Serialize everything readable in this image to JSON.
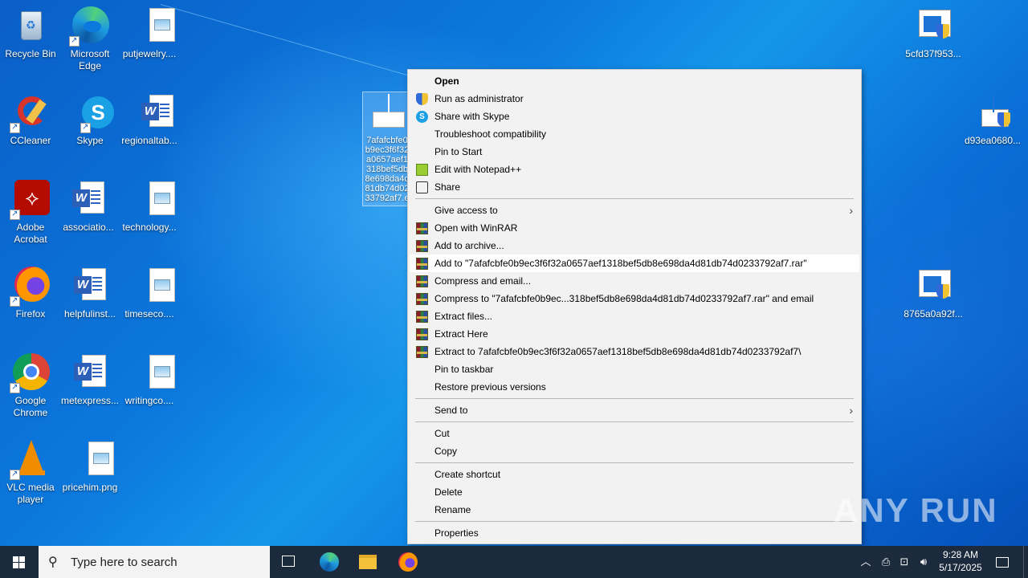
{
  "desktop": {
    "icons": [
      {
        "label": "Recycle Bin"
      },
      {
        "label": "Microsoft Edge"
      },
      {
        "label": "putjewelry...."
      },
      {
        "label": "CCleaner"
      },
      {
        "label": "Skype"
      },
      {
        "label": "regionaltab..."
      },
      {
        "label": "Adobe Acrobat"
      },
      {
        "label": "associatio..."
      },
      {
        "label": "technology..."
      },
      {
        "label": "Firefox"
      },
      {
        "label": "helpfulinst..."
      },
      {
        "label": "timeseco...."
      },
      {
        "label": "Google Chrome"
      },
      {
        "label": "metexpress..."
      },
      {
        "label": "writingco...."
      },
      {
        "label": "VLC media player"
      },
      {
        "label": "pricehim.png"
      },
      {
        "label": "5cfd37f953..."
      },
      {
        "label": "d93ea0680..."
      },
      {
        "label": "8765a0a92f..."
      }
    ],
    "selected_file_label": "7afafcbfe0b9ec3f6f32a0657aef1318bef5db8e698da4d81db74d0233792af7.exe"
  },
  "context_menu": {
    "items": [
      {
        "label": "Open"
      },
      {
        "label": "Run as administrator"
      },
      {
        "label": "Share with Skype"
      },
      {
        "label": "Troubleshoot compatibility"
      },
      {
        "label": "Pin to Start"
      },
      {
        "label": "Edit with Notepad++"
      },
      {
        "label": "Share"
      },
      {
        "label": "Give access to"
      },
      {
        "label": "Open with WinRAR"
      },
      {
        "label": "Add to archive..."
      },
      {
        "label": "Add to \"7afafcbfe0b9ec3f6f32a0657aef1318bef5db8e698da4d81db74d0233792af7.rar\""
      },
      {
        "label": "Compress and email..."
      },
      {
        "label": "Compress to \"7afafcbfe0b9ec...318bef5db8e698da4d81db74d0233792af7.rar\" and email"
      },
      {
        "label": "Extract files..."
      },
      {
        "label": "Extract Here"
      },
      {
        "label": "Extract to 7afafcbfe0b9ec3f6f32a0657aef1318bef5db8e698da4d81db74d0233792af7\\"
      },
      {
        "label": "Pin to taskbar"
      },
      {
        "label": "Restore previous versions"
      },
      {
        "label": "Send to"
      },
      {
        "label": "Cut"
      },
      {
        "label": "Copy"
      },
      {
        "label": "Create shortcut"
      },
      {
        "label": "Delete"
      },
      {
        "label": "Rename"
      },
      {
        "label": "Properties"
      }
    ],
    "submenu_arrow": "›"
  },
  "taskbar": {
    "search_placeholder": "Type here to search",
    "time": "9:28 AM",
    "date": "5/17/2025"
  },
  "watermark": "ANY RUN",
  "colors": {
    "wallpaper": "#0b78dd",
    "taskbar": "#1c2a3d",
    "menu_bg": "#f2f2f2",
    "menu_hover": "#ffffff"
  }
}
